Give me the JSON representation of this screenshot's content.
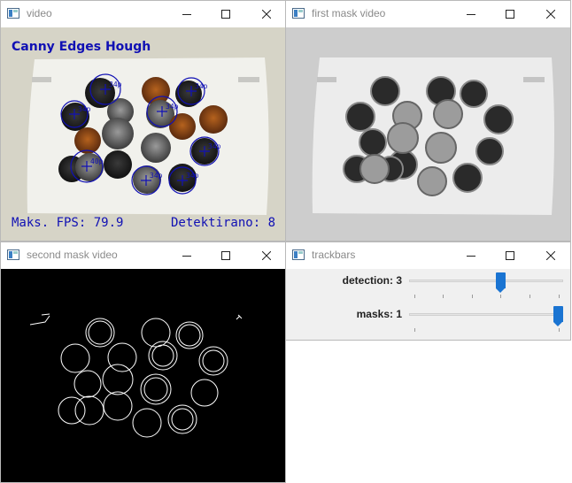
{
  "windows": {
    "video": {
      "title": "video",
      "overlay": {
        "heading": "Canny Edges Hough",
        "fps_text": "Maks. FPS: 79.9",
        "detected_text": "Detektirano: 8"
      },
      "circle_labels": [
        "34p",
        "34p",
        "34p",
        "34p",
        "34p",
        "40p",
        "34p",
        "34p"
      ]
    },
    "first_mask": {
      "title": "first mask video"
    },
    "second_mask": {
      "title": "second mask video"
    },
    "trackbars": {
      "title": "trackbars",
      "bars": [
        {
          "label": "detection: 3",
          "value": 3,
          "max": 5,
          "ticks": 6
        },
        {
          "label": "masks: 1",
          "value": 1,
          "max": 1,
          "ticks": 2
        }
      ]
    }
  },
  "colors": {
    "accent": "#1a74d2",
    "overlay_text": "#1010b4",
    "title_text": "#8a8a8a"
  },
  "icons": [
    "app-icon",
    "minimize-icon",
    "maximize-icon",
    "close-icon"
  ]
}
